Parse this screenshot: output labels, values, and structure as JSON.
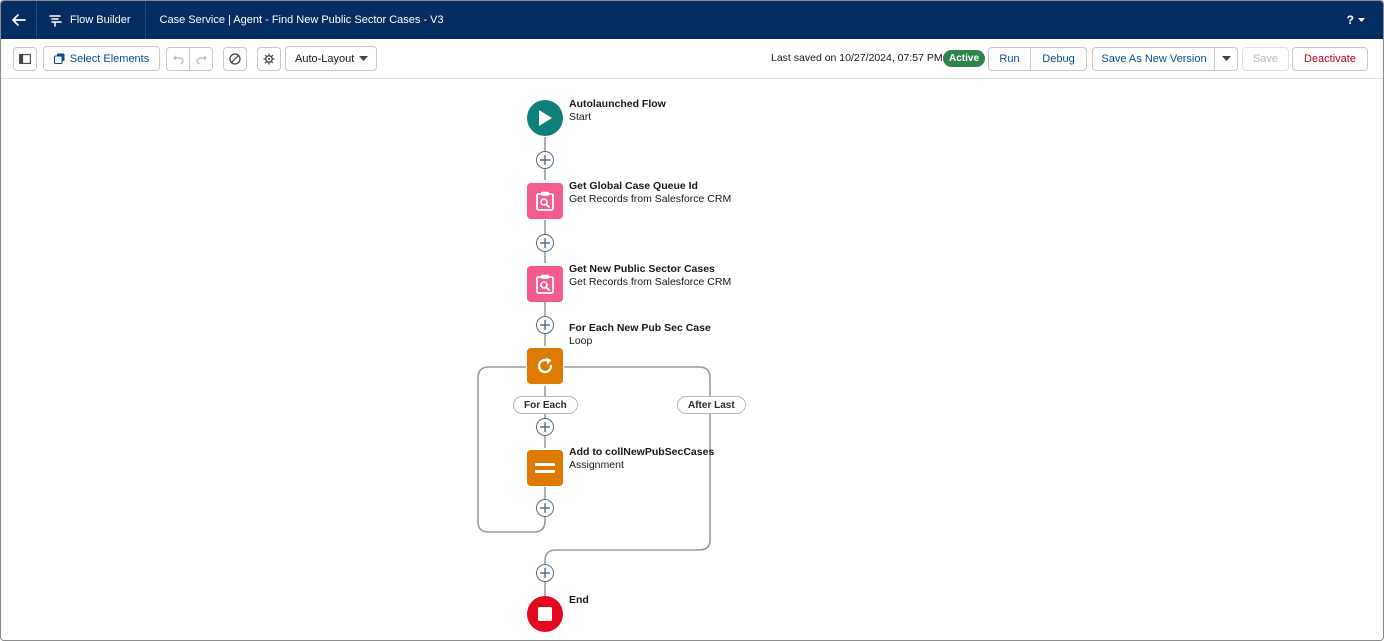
{
  "header": {
    "app_name": "Flow Builder",
    "flow_title": "Case Service | Agent - Find New Public Sector Cases - V3",
    "help_label": "?"
  },
  "toolbar": {
    "select_elements_label": "Select Elements",
    "layout_select_value": "Auto-Layout",
    "last_saved": "Last saved on 10/27/2024, 07:57 PM",
    "status_badge": "Active",
    "run_label": "Run",
    "debug_label": "Debug",
    "save_as_new_version_label": "Save As New Version",
    "save_label": "Save",
    "deactivate_label": "Deactivate"
  },
  "flow": {
    "start": {
      "title": "Autolaunched Flow",
      "subtitle": "Start",
      "icon": "play-icon",
      "color": "#0f7f7a"
    },
    "get_queue": {
      "title": "Get Global Case Queue Id",
      "subtitle": "Get Records from Salesforce CRM",
      "icon": "get-records-icon",
      "color": "#f45b91"
    },
    "get_cases": {
      "title": "Get New Public Sector Cases",
      "subtitle": "Get Records from Salesforce CRM",
      "icon": "get-records-icon",
      "color": "#f45b91"
    },
    "loop": {
      "title": "For Each New Pub Sec Case",
      "subtitle": "Loop",
      "icon": "loop-icon",
      "color": "#dd7a01"
    },
    "for_each_label": "For Each",
    "after_last_label": "After Last",
    "assignment": {
      "title": "Add to collNewPubSecCases",
      "subtitle": "Assignment",
      "icon": "assignment-icon",
      "color": "#dd7a01"
    },
    "end": {
      "title": "End",
      "icon": "stop-icon",
      "color": "#e3081f"
    }
  },
  "colors": {
    "header_bg": "#032d60",
    "link_blue": "#0b4d8a",
    "active_green": "#2e844a",
    "deactivate_red": "#ba0517"
  }
}
